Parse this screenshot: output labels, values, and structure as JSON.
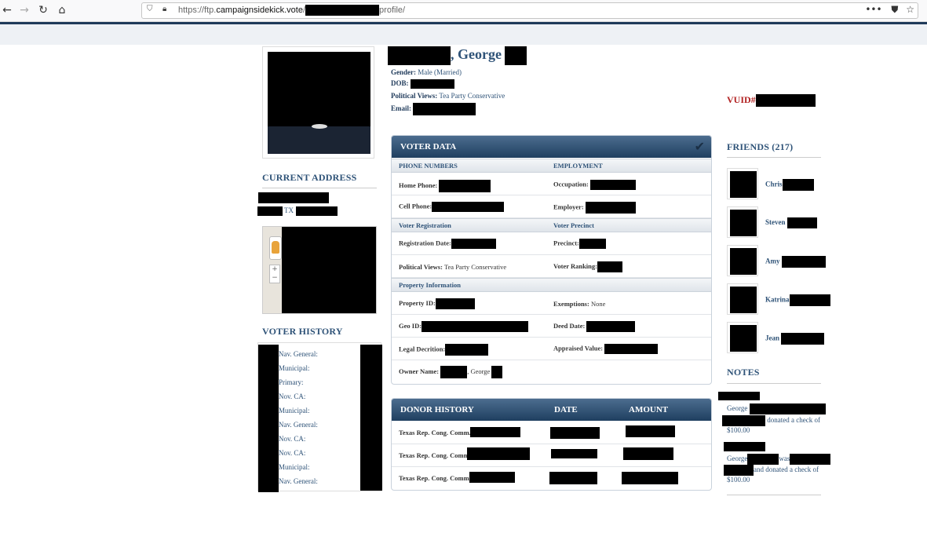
{
  "browser": {
    "url_prefix": "https://ftp.",
    "url_domain": "campaignsidekick.vote",
    "url_sep": "/",
    "url_suffix": "profile/",
    "menu_icon": "•••",
    "pocket_icon": "pocket-icon",
    "star_icon": "star-icon"
  },
  "profile": {
    "name_visible": ", George",
    "gender_label": "Gender:",
    "gender_value": "Male (Married)",
    "dob_label": "DOB:",
    "views_label": "Political Views:",
    "views_value": "Tea Party Conservative",
    "email_label": "Email:"
  },
  "left": {
    "current_address_title": "CURRENT ADDRESS",
    "address_state": "TX",
    "voter_history_title": "VOTER HISTORY",
    "voter_history": [
      "Nav. General:",
      "Municipal:",
      "Primary:",
      "Nov. CA:",
      "Municipal:",
      "Nav. General:",
      "Nov. CA:",
      "Nov. CA:",
      "Municipal:",
      "Nav. General:"
    ]
  },
  "voter_data": {
    "title": "VOTER DATA",
    "phone_header": "PHONE NUMBERS",
    "employment_header": "EMPLOYMENT",
    "home_phone": "Home Phone:",
    "occupation": "Occupation:",
    "cell_phone": "Cell Phone:",
    "employer": "Employer:",
    "voter_registration": "Voter Registration",
    "voter_precinct": "Voter Precinct",
    "registration_date": "Registration Date:",
    "precinct": "Precinct:",
    "political_views": "Political Views:",
    "political_views_value": "Tea Party Conservative",
    "voter_ranking": "Voter Ranking:",
    "property_information": "Property Information",
    "property_id": "Property ID:",
    "exemptions": "Exemptions:",
    "exemptions_value": "None",
    "geo_id": "Geo ID:",
    "deed_date": "Deed Date:",
    "legal_description": "Legal Decrition:",
    "appraised_value": "Appraised Value:",
    "owner_name": "Owner Name:",
    "owner_name_visible": ", George"
  },
  "donor_history": {
    "title": "DONOR HISTORY",
    "date_header": "DATE",
    "amount_header": "AMOUNT",
    "rows": [
      "Texas Rep. Cong. Comm.",
      "Texas Rep. Cong. Comm.",
      "Texas Rep. Cong. Comm."
    ]
  },
  "right": {
    "vuid_label": "VUID#",
    "friends_title": "FRIENDS (217)",
    "friends": [
      "Chris",
      "Steven",
      "Amy",
      "Katrina",
      "Jean"
    ],
    "notes_title": "NOTES",
    "note1_name": "George",
    "note1_text": "donated a check of",
    "note1_amount": "$100.00",
    "note2_name": "George",
    "note2_was": "was",
    "note2_text": "and donated a check of",
    "note2_amount": "$100.00"
  }
}
